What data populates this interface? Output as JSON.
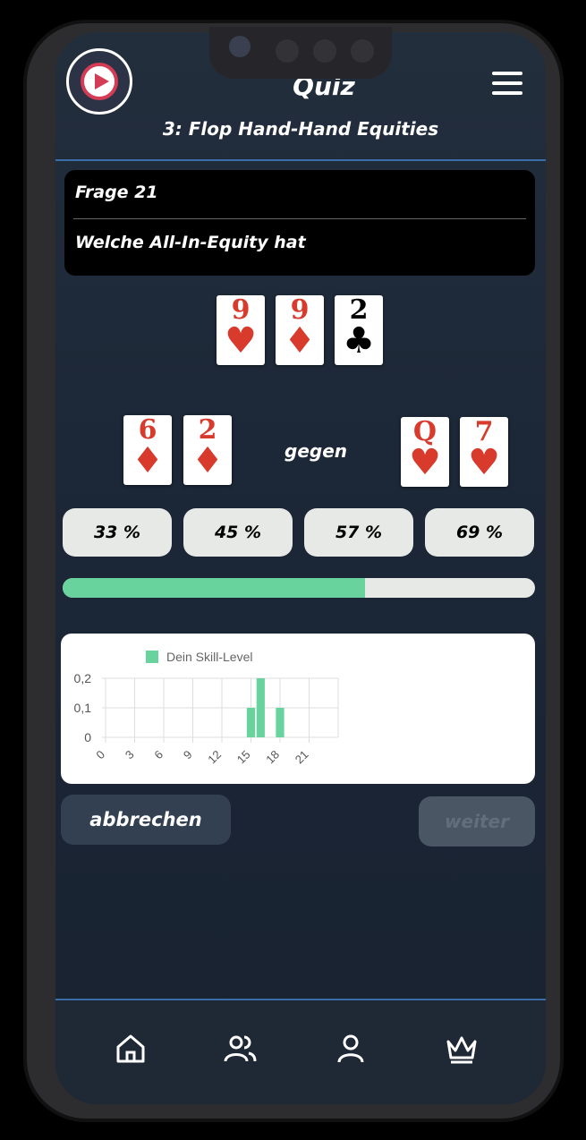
{
  "header": {
    "title": "Quiz",
    "subtitle": "3: Flop Hand-Hand Equities"
  },
  "question": {
    "number_label": "Frage 21",
    "text": "Welche All-In-Equity hat"
  },
  "board": [
    {
      "rank": "9",
      "suit": "♥",
      "color": "#d83a2c"
    },
    {
      "rank": "9",
      "suit": "♦",
      "color": "#d83a2c"
    },
    {
      "rank": "2",
      "suit": "♣",
      "color": "#000000"
    }
  ],
  "hand_left": [
    {
      "rank": "6",
      "suit": "♦",
      "color": "#d83a2c"
    },
    {
      "rank": "2",
      "suit": "♦",
      "color": "#d83a2c"
    }
  ],
  "versus_label": "gegen",
  "hand_right": [
    {
      "rank": "Q",
      "suit": "♥",
      "color": "#d83a2c"
    },
    {
      "rank": "7",
      "suit": "♥",
      "color": "#d83a2c"
    }
  ],
  "answers": [
    "33 %",
    "45 %",
    "57 %",
    "69 %"
  ],
  "timer": {
    "fraction": 0.64,
    "color": "#69d39e"
  },
  "chart_data": {
    "type": "bar",
    "legend": "Dein Skill-Level",
    "legend_position": "top",
    "color": "#69d39e",
    "x_ticks": [
      "0",
      "3",
      "6",
      "9",
      "12",
      "15",
      "18",
      "21"
    ],
    "y_ticks": [
      "0",
      "0,1",
      "0,2"
    ],
    "ylim": [
      0,
      0.2
    ],
    "xlim": [
      0,
      24
    ],
    "grid": true,
    "bars": [
      {
        "x": 15,
        "y": 0.1
      },
      {
        "x": 16,
        "y": 0.2
      },
      {
        "x": 18,
        "y": 0.1
      }
    ]
  },
  "buttons": {
    "cancel": "abbrechen",
    "next": "weiter"
  },
  "nav": [
    "home-icon",
    "users-icon",
    "profile-icon",
    "crown-icon"
  ],
  "colors": {
    "accent": "#69d39e",
    "background": "#1c2737",
    "card_red": "#d83a2c",
    "logo_red": "#d43b55"
  }
}
